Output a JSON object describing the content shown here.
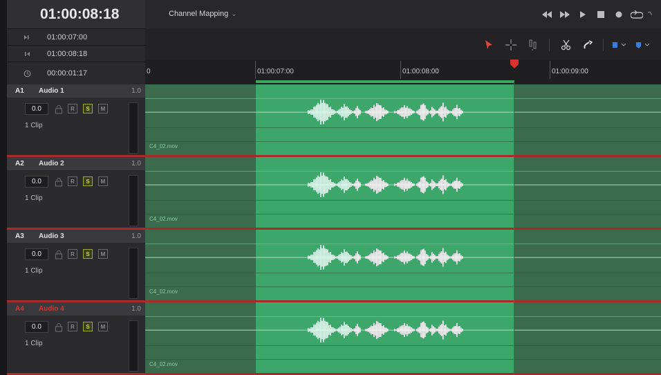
{
  "header": {
    "main_timecode": "01:00:08:18",
    "rows": [
      {
        "icon": "in-point-icon",
        "value": "01:00:07:00"
      },
      {
        "icon": "out-point-icon",
        "value": "01:00:08:18"
      },
      {
        "icon": "duration-icon",
        "value": "00:00:01:17"
      }
    ]
  },
  "topbar": {
    "channel_mapping_label": "Channel Mapping",
    "transport_icons": [
      "rewind-icon",
      "fast-forward-icon",
      "play-icon",
      "stop-icon",
      "record-icon",
      "loop-icon"
    ]
  },
  "ruler": {
    "partial_label": "0",
    "labels": [
      "01:00:07:00",
      "01:00:08:00",
      "01:00:09:00"
    ]
  },
  "tracks": [
    {
      "id": "A1",
      "name": "Audio 1",
      "volume": "1.0",
      "level": "0.0",
      "clip_count": "1 Clip",
      "clip_name": "C4_02.mov",
      "muted": false
    },
    {
      "id": "A2",
      "name": "Audio 2",
      "volume": "1.0",
      "level": "0.0",
      "clip_count": "1 Clip",
      "clip_name": "C4_02.mov",
      "muted": false
    },
    {
      "id": "A3",
      "name": "Audio 3",
      "volume": "1.0",
      "level": "0.0",
      "clip_count": "1 Clip",
      "clip_name": "C4_02.mov",
      "muted": false
    },
    {
      "id": "A4",
      "name": "Audio 4",
      "volume": "1.0",
      "level": "0.0",
      "clip_count": "1 Clip",
      "clip_name": "C4_02.mov",
      "muted": true
    }
  ],
  "track_buttons": {
    "r": "R",
    "s": "S",
    "m": "M"
  },
  "colors": {
    "selection_green": "#3da66a",
    "lane_green": "#3a6b4c",
    "playhead_red": "#c9302c",
    "solo_yellow": "#cfd84a"
  }
}
